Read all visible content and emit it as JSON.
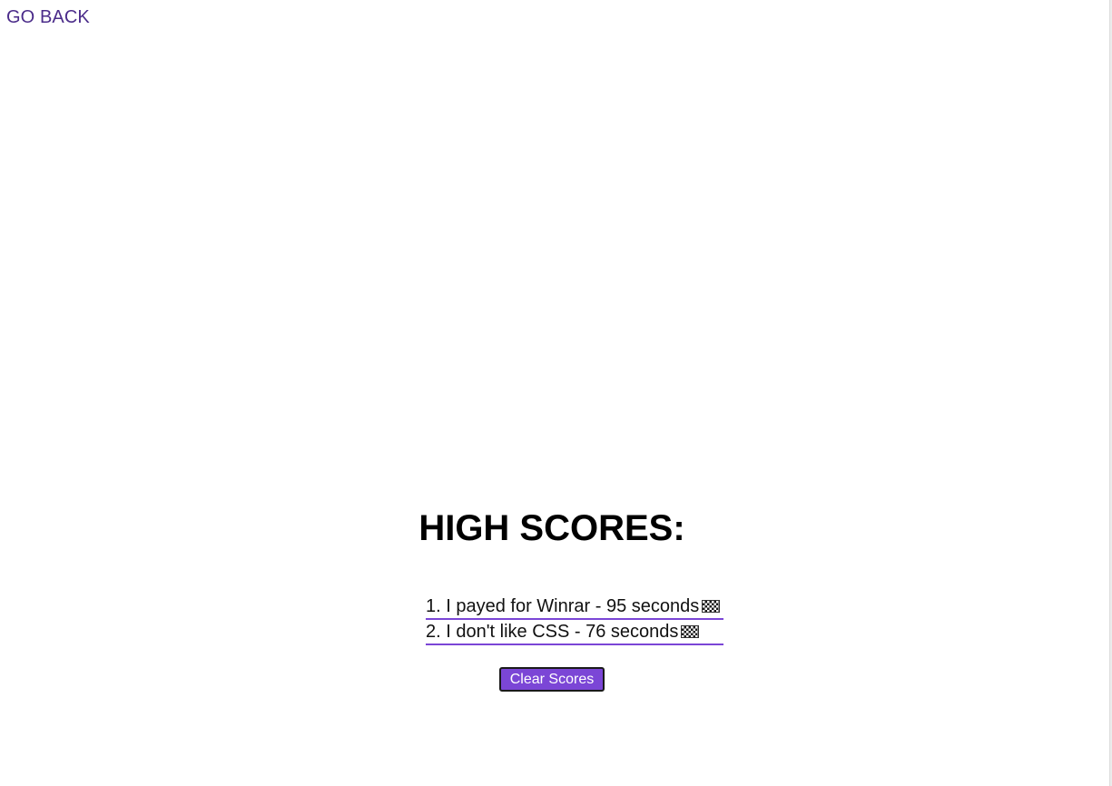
{
  "nav": {
    "go_back_label": "GO BACK"
  },
  "main": {
    "title": "HIGH SCORES:",
    "scores": [
      {
        "text": "1. I payed for Winrar - 95 seconds",
        "icon": "checkered-flag-icon"
      },
      {
        "text": "2. I don't like CSS - 76 seconds",
        "icon": "checkered-flag-icon"
      }
    ],
    "clear_button_label": "Clear Scores"
  },
  "colors": {
    "accent": "#7b46d6",
    "link": "#4b2c8a",
    "text": "#000000",
    "background": "#ffffff"
  }
}
